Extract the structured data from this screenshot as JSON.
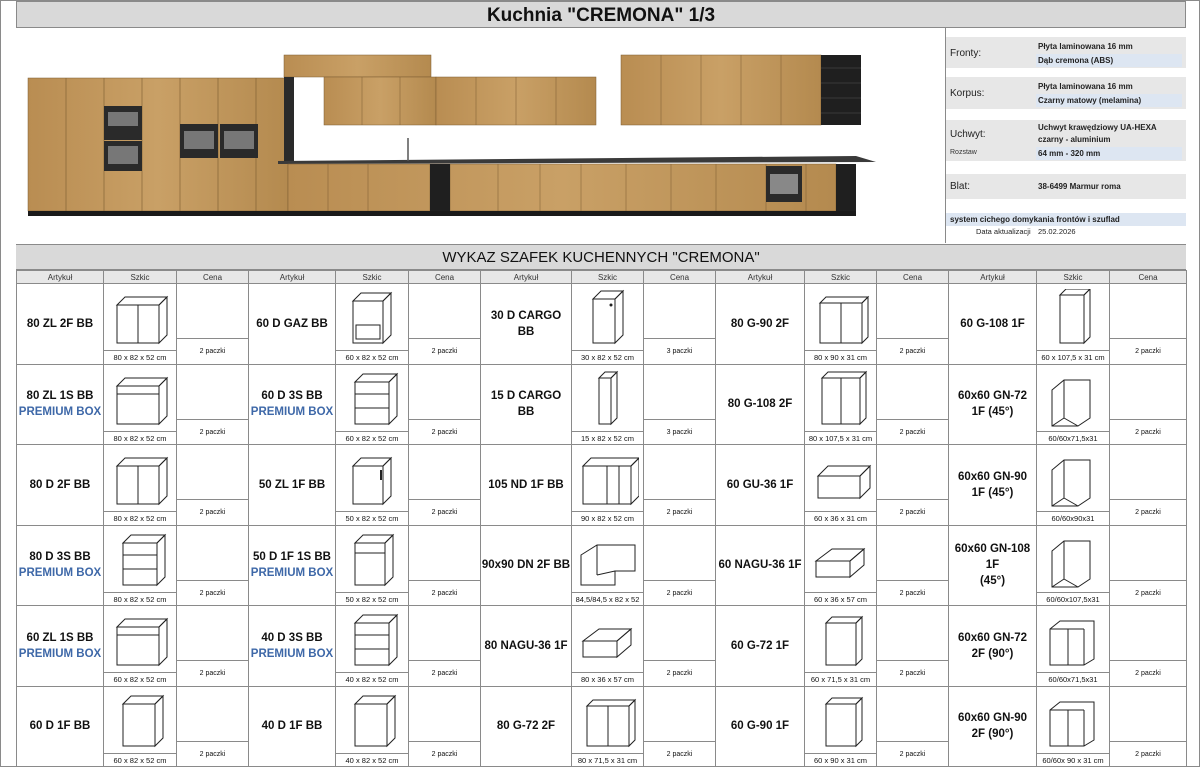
{
  "title": "Kuchnia \"CREMONA\" 1/3",
  "spec": {
    "fronty_label": "Fronty:",
    "fronty_val1": "Płyta laminowana 16 mm",
    "fronty_val2": "Dąb cremona (ABS)",
    "korpus_label": "Korpus:",
    "korpus_val1": "Płyta laminowana 16 mm",
    "korpus_val2": "Czarny matowy (melamina)",
    "uchwyt_label": "Uchwyt:",
    "uchwyt_val1": "Uchwyt krawędziowy UA-HEXA",
    "uchwyt_val2": "czarny - aluminium",
    "rozstaw_label": "Rozstaw",
    "rozstaw_val": "64 mm - 320 mm",
    "blat_label": "Blat:",
    "blat_val": "38-6499 Marmur roma",
    "system": "system cichego domykania frontów i szuflad",
    "update_label": "Data aktualizacji",
    "update_date": "25.02.2026"
  },
  "list_title": "WYKAZ SZAFEK KUCHENNYCH \"CREMONA\"",
  "headers": {
    "artykul": "Artykuł",
    "szkic": "Szkic",
    "cena": "Cena"
  },
  "colors": {
    "premium": "#3e68a8",
    "wood": "#c49a5c",
    "body": "#1a1a1a",
    "header_bg": "#d9d9d9",
    "spec_bg": "#dde6f2"
  },
  "rows": [
    [
      {
        "name": "80 ZL 2F BB",
        "sub": "",
        "dim": "80 x 82 x 52 cm",
        "pk": "2 paczki",
        "icon": "sink-cabinet-2-door"
      },
      {
        "name": "60 D GAZ BB",
        "sub": "",
        "dim": "60 x 82 x 52 cm",
        "pk": "2 paczki",
        "icon": "oven-cabinet"
      },
      {
        "name": "30 D CARGO BB",
        "sub": "",
        "dim": "30 x 82 x 52 cm",
        "pk": "3 paczki",
        "icon": "cargo-cabinet"
      },
      {
        "name": "80 G-90 2F",
        "sub": "",
        "dim": "80 x 90 x 31 cm",
        "pk": "2 paczki",
        "icon": "wall-cabinet-2-door"
      },
      {
        "name": "60 G-108 1F",
        "sub": "",
        "dim": "60 x 107,5 x 31 cm",
        "pk": "2 paczki",
        "icon": "wall-cabinet-tall"
      }
    ],
    [
      {
        "name": "80 ZL 1S BB",
        "sub": "PREMIUM BOX",
        "dim": "80 x 82 x 52 cm",
        "pk": "2 paczki",
        "icon": "sink-drawer-cabinet"
      },
      {
        "name": "60 D 3S BB",
        "sub": "PREMIUM BOX",
        "dim": "60 x 82 x 52 cm",
        "pk": "2 paczki",
        "icon": "3-drawer-cabinet"
      },
      {
        "name": "15 D CARGO BB",
        "sub": "",
        "dim": "15 x 82 x 52 cm",
        "pk": "3 paczki",
        "icon": "narrow-cargo-cabinet"
      },
      {
        "name": "80 G-108 2F",
        "sub": "",
        "dim": "80 x 107,5 x 31 cm",
        "pk": "2 paczki",
        "icon": "wall-cabinet-2-door-tall"
      },
      {
        "name": "60x60 GN-72",
        "sub2": "1F (45°)",
        "sub": "",
        "dim": "60/60x71,5x31",
        "pk": "2 paczki",
        "icon": "corner-wall-cabinet-45"
      }
    ],
    [
      {
        "name": "80 D 2F BB",
        "sub": "",
        "dim": "80 x 82 x 52 cm",
        "pk": "2 paczki",
        "icon": "base-cabinet-2-door"
      },
      {
        "name": "50 ZL 1F BB",
        "sub": "",
        "dim": "50 x 82 x 52 cm",
        "pk": "2 paczki",
        "icon": "sink-cabinet-1-door"
      },
      {
        "name": "105 ND 1F BB",
        "sub": "",
        "dim": "90 x 82 x 52 cm",
        "pk": "2 paczki",
        "icon": "corner-base-cabinet"
      },
      {
        "name": "60 GU-36 1F",
        "sub": "",
        "dim": "60 x 36 x 31 cm",
        "pk": "2 paczki",
        "icon": "flap-wall-cabinet"
      },
      {
        "name": "60x60 GN-90",
        "sub2": "1F (45°)",
        "sub": "",
        "dim": "60/60x90x31",
        "pk": "2 paczki",
        "icon": "corner-wall-cabinet-45"
      }
    ],
    [
      {
        "name": "80 D 3S BB",
        "sub": "PREMIUM BOX",
        "dim": "80 x 82 x 52 cm",
        "pk": "2 paczki",
        "icon": "3-drawer-cabinet"
      },
      {
        "name": "50 D 1F 1S BB",
        "sub": "PREMIUM BOX",
        "dim": "50 x 82 x 52 cm",
        "pk": "2 paczki",
        "icon": "door-drawer-cabinet"
      },
      {
        "name": "90x90 DN 2F BB",
        "sub": "",
        "dim": "84,5/84,5 x 82 x 52",
        "pk": "2 paczki",
        "icon": "l-corner-cabinet"
      },
      {
        "name": "60 NAGU-36 1F",
        "sub": "",
        "dim": "60 x 36 x 57 cm",
        "pk": "2 paczki",
        "icon": "flap-wall-cabinet-deep"
      },
      {
        "name": "60x60 GN-108",
        "sub2": "1F",
        "sub3": "(45°)",
        "sub": "",
        "dim": "60/60x107,5x31",
        "pk": "2 paczki",
        "icon": "corner-wall-cabinet-45"
      }
    ],
    [
      {
        "name": "60 ZL 1S BB",
        "sub": "PREMIUM BOX",
        "dim": "60 x 82 x 52 cm",
        "pk": "2 paczki",
        "icon": "sink-drawer-cabinet"
      },
      {
        "name": "40 D 3S BB",
        "sub": "PREMIUM BOX",
        "dim": "40 x 82 x 52 cm",
        "pk": "2 paczki",
        "icon": "3-drawer-cabinet"
      },
      {
        "name": "80 NAGU-36 1F",
        "sub": "",
        "dim": "80 x 36 x 57 cm",
        "pk": "2 paczki",
        "icon": "flap-wall-cabinet-deep"
      },
      {
        "name": "60 G-72 1F",
        "sub": "",
        "dim": "60 x 71,5 x 31 cm",
        "pk": "2 paczki",
        "icon": "wall-cabinet-1-door"
      },
      {
        "name": "60x60 GN-72",
        "sub2": "2F (90°)",
        "sub": "",
        "dim": "60/60x71,5x31",
        "pk": "2 paczki",
        "icon": "corner-wall-cabinet-90"
      }
    ],
    [
      {
        "name": "60 D 1F BB",
        "sub": "",
        "dim": "60 x 82 x 52 cm",
        "pk": "2 paczki",
        "icon": "base-cabinet-1-door"
      },
      {
        "name": "40 D 1F BB",
        "sub": "",
        "dim": "40 x 82 x 52 cm",
        "pk": "2 paczki",
        "icon": "base-cabinet-1-door"
      },
      {
        "name": "80 G-72 2F",
        "sub": "",
        "dim": "80 x 71,5 x 31 cm",
        "pk": "2 paczki",
        "icon": "wall-cabinet-2-door"
      },
      {
        "name": "60 G-90 1F",
        "sub": "",
        "dim": "60 x 90 x 31 cm",
        "pk": "2 paczki",
        "icon": "wall-cabinet-1-door"
      },
      {
        "name": "60x60 GN-90",
        "sub2": "2F (90°)",
        "sub": "",
        "dim": "60/60x 90 x 31 cm",
        "pk": "2 paczki",
        "icon": "corner-wall-cabinet-90"
      }
    ]
  ]
}
